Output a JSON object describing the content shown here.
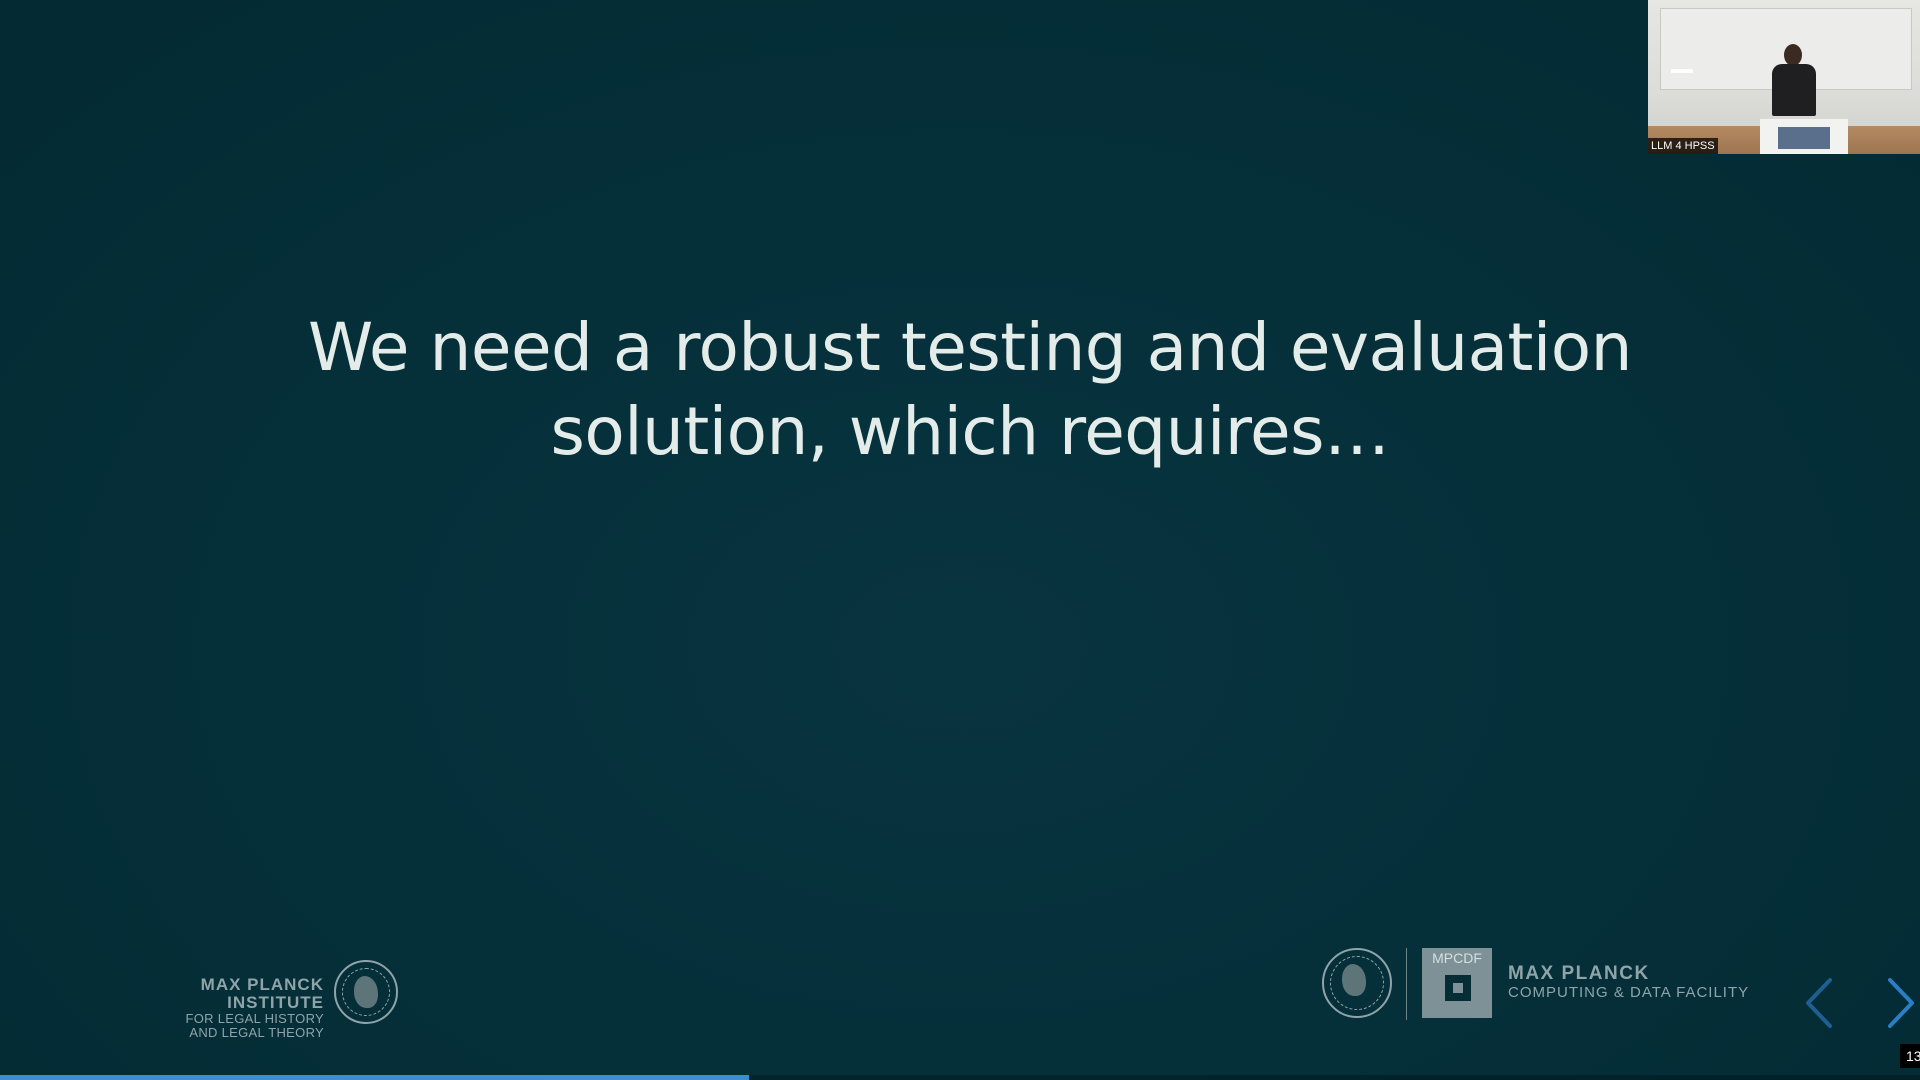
{
  "slide": {
    "title_lines": [
      "We need a robust testing and evaluation",
      "solution, which requires…"
    ]
  },
  "webcam": {
    "label": "LLM 4 HPSS"
  },
  "footer": {
    "left_logo": {
      "name": "MAX PLANCK INSTITUTE",
      "sub_line1": "FOR LEGAL HISTORY",
      "sub_line2": "AND LEGAL THEORY",
      "seal_icon": "minerva-seal-icon"
    },
    "right_logo": {
      "box_label": "MPCDF",
      "name": "MAX PLANCK",
      "sub": "COMPUTING & DATA FACILITY",
      "seal_icon": "minerva-seal-icon"
    }
  },
  "navigation": {
    "prev_icon": "chevron-left-icon",
    "next_icon": "chevron-right-icon",
    "arrow_color": "#1f6fb0"
  },
  "progress": {
    "fraction": 0.39,
    "color": "#3a8fd0"
  },
  "slide_counter": {
    "text": "13"
  }
}
